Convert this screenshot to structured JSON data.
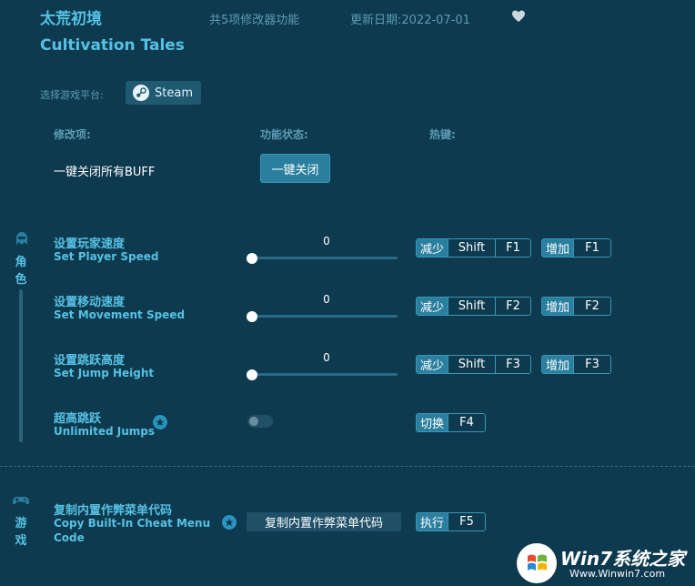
{
  "header": {
    "title_cn": "太荒初境",
    "title_en": "Cultivation Tales",
    "features": "共5项修改器功能",
    "updated": "更新日期:2022-07-01"
  },
  "platform": {
    "label": "选择游戏平台:",
    "steam_label": "Steam"
  },
  "columns": {
    "item": "修改项:",
    "status": "功能状态:",
    "hotkey": "热键:"
  },
  "buff": {
    "label": "一键关闭所有BUFF",
    "button": "一键关闭"
  },
  "categories": {
    "role": [
      "角",
      "色"
    ],
    "game": [
      "游",
      "戏"
    ]
  },
  "cheats": [
    {
      "cn": "设置玩家速度",
      "en": "Set Player Speed",
      "value": "0",
      "hotkeys": [
        {
          "action": "减少",
          "keys": [
            "Shift",
            "F1"
          ]
        },
        {
          "action": "增加",
          "keys": [
            "F1"
          ]
        }
      ]
    },
    {
      "cn": "设置移动速度",
      "en": "Set Movement Speed",
      "value": "0",
      "hotkeys": [
        {
          "action": "减少",
          "keys": [
            "Shift",
            "F2"
          ]
        },
        {
          "action": "增加",
          "keys": [
            "F2"
          ]
        }
      ]
    },
    {
      "cn": "设置跳跃高度",
      "en": "Set Jump Height",
      "value": "0",
      "hotkeys": [
        {
          "action": "减少",
          "keys": [
            "Shift",
            "F3"
          ]
        },
        {
          "action": "增加",
          "keys": [
            "F3"
          ]
        }
      ]
    },
    {
      "cn": "超高跳跃",
      "en": "Unlimited Jumps",
      "toggle_on": false,
      "hotkeys": [
        {
          "action": "切换",
          "keys": [
            "F4"
          ]
        }
      ]
    }
  ],
  "game_cheat": {
    "cn": "复制内置作弊菜单代码",
    "en_line1": "Copy Built-In Cheat Menu",
    "en_line2": "Code",
    "button": "复制内置作弊菜单代码",
    "hotkey": {
      "action": "执行",
      "keys": [
        "F5"
      ]
    }
  },
  "watermark": {
    "brand": "Win7系统之家",
    "url": "Www.Winwin7.com"
  },
  "colors": {
    "background": "#0d3a4f",
    "accent": "#57c1e3",
    "button": "#2a7f9f",
    "muted": "#5d9cb3"
  }
}
